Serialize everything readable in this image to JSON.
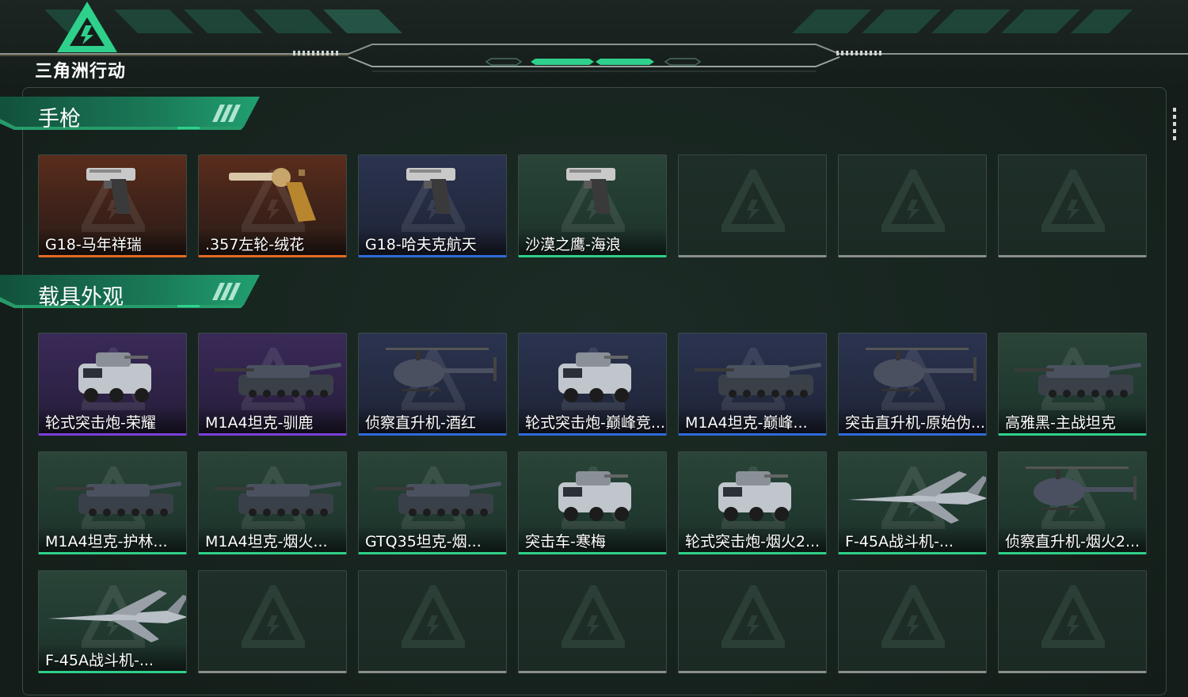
{
  "app": {
    "logo_text": "三角洲行动"
  },
  "sections": [
    {
      "title": "手枪",
      "items": [
        {
          "name": "G18-马年祥瑞",
          "rarity": "orange",
          "icon": "pistol-icon"
        },
        {
          "name": ".357左轮-绒花",
          "rarity": "orange",
          "icon": "revolver-icon"
        },
        {
          "name": "G18-哈夫克航天",
          "rarity": "blue",
          "icon": "pistol-icon"
        },
        {
          "name": "沙漠之鹰-海浪",
          "rarity": "green",
          "icon": "pistol-icon"
        },
        {
          "name": "",
          "rarity": "empty"
        },
        {
          "name": "",
          "rarity": "empty"
        },
        {
          "name": "",
          "rarity": "empty"
        }
      ]
    },
    {
      "title": "载具外观",
      "items": [
        {
          "name": "轮式突击炮-荣耀",
          "rarity": "purple",
          "icon": "armored-car-icon"
        },
        {
          "name": "M1A4坦克-驯鹿",
          "rarity": "purple",
          "icon": "tank-icon"
        },
        {
          "name": "侦察直升机-酒红",
          "rarity": "blue",
          "icon": "helicopter-icon"
        },
        {
          "name": "轮式突击炮-巅峰竞...",
          "rarity": "blue",
          "icon": "armored-car-icon"
        },
        {
          "name": "M1A4坦克-巅峰...",
          "rarity": "blue",
          "icon": "tank-icon"
        },
        {
          "name": "突击直升机-原始伪...",
          "rarity": "blue",
          "icon": "helicopter-icon"
        },
        {
          "name": "高雅黑-主战坦克",
          "rarity": "green",
          "icon": "tank-icon"
        },
        {
          "name": "M1A4坦克-护林...",
          "rarity": "green",
          "icon": "tank-icon"
        },
        {
          "name": "M1A4坦克-烟火...",
          "rarity": "green",
          "icon": "tank-icon"
        },
        {
          "name": "GTQ35坦克-烟...",
          "rarity": "green",
          "icon": "tank-icon"
        },
        {
          "name": "突击车-寒梅",
          "rarity": "green",
          "icon": "armored-car-icon"
        },
        {
          "name": "轮式突击炮-烟火2...",
          "rarity": "green",
          "icon": "armored-car-icon"
        },
        {
          "name": "F-45A战斗机-...",
          "rarity": "green",
          "icon": "jet-icon"
        },
        {
          "name": "侦察直升机-烟火2...",
          "rarity": "green",
          "icon": "helicopter-icon"
        },
        {
          "name": "F-45A战斗机-...",
          "rarity": "green",
          "icon": "jet-icon"
        },
        {
          "name": "",
          "rarity": "empty"
        },
        {
          "name": "",
          "rarity": "empty"
        },
        {
          "name": "",
          "rarity": "empty"
        },
        {
          "name": "",
          "rarity": "empty"
        },
        {
          "name": "",
          "rarity": "empty"
        },
        {
          "name": "",
          "rarity": "empty"
        }
      ]
    }
  ]
}
